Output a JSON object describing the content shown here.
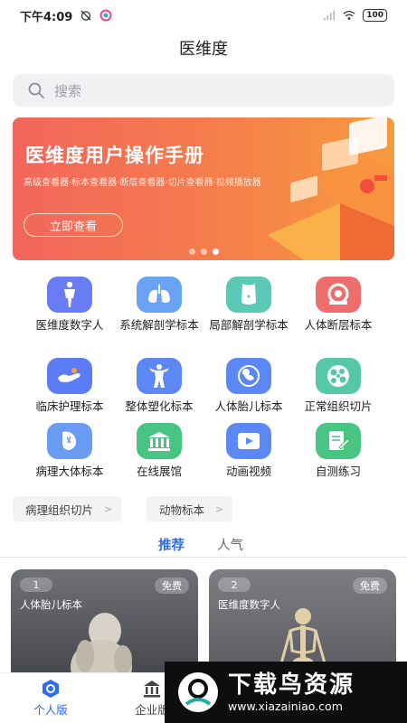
{
  "status": {
    "time": "下午4:09",
    "battery": "100"
  },
  "app": {
    "title": "医维度"
  },
  "search": {
    "placeholder": "搜索"
  },
  "banner": {
    "title": "医维度用户操作手册",
    "subtitle": "高级查看器·标本查看器·断层查看器·切片查看器·视频播放器",
    "button": "立即查看",
    "dots": 3,
    "active_dot": 3
  },
  "grid": [
    {
      "label": "医维度数字人",
      "icon": "human-body-icon",
      "color": "#6a7cf4"
    },
    {
      "label": "系统解剖学标本",
      "icon": "lungs-icon",
      "color": "#6aa3f4"
    },
    {
      "label": "局部解剖学标本",
      "icon": "torso-icon",
      "color": "#5cc9b5"
    },
    {
      "label": "人体断层标本",
      "icon": "ct-scanner-icon",
      "color": "#f06d6d"
    },
    {
      "label": "临床护理标本",
      "icon": "hand-care-icon",
      "color": "#5b7cf6"
    },
    {
      "label": "整体塑化标本",
      "icon": "bodybuilder-icon",
      "color": "#5b88f4"
    },
    {
      "label": "人体胎儿标本",
      "icon": "fetus-icon",
      "color": "#5b88f4"
    },
    {
      "label": "正常组织切片",
      "icon": "tissue-cells-icon",
      "color": "#55c8a8"
    },
    {
      "label": "病理大体标本",
      "icon": "pathology-icon",
      "color": "#6a9cf4"
    },
    {
      "label": "在线展馆",
      "icon": "museum-icon",
      "color": "#48c483"
    },
    {
      "label": "动画视频",
      "icon": "video-icon",
      "color": "#5b88f4"
    },
    {
      "label": "自测练习",
      "icon": "exercise-icon",
      "color": "#48c483"
    }
  ],
  "chips": [
    {
      "label": "病理组织切片"
    },
    {
      "label": "动物标本"
    }
  ],
  "tabs": [
    {
      "label": "推荐",
      "active": true
    },
    {
      "label": "人气",
      "active": false
    }
  ],
  "cards": [
    {
      "rank": "1",
      "badge": "免费",
      "title": "人体胎儿标本"
    },
    {
      "rank": "2",
      "badge": "免费",
      "title": "医维度数字人"
    }
  ],
  "bottom_nav": [
    {
      "label": "个人版",
      "active": true
    },
    {
      "label": "企业版",
      "active": false
    }
  ],
  "watermark": {
    "title": "下载鸟资源",
    "url": "www.xiazainiao.com"
  }
}
